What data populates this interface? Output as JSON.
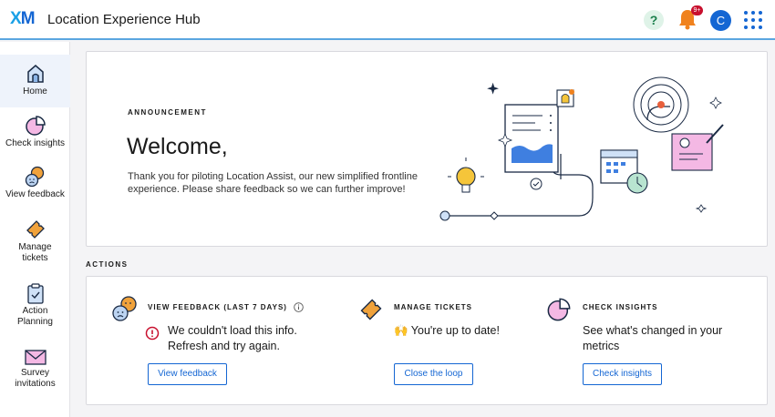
{
  "header": {
    "logo": "XM",
    "title": "Location Experience Hub",
    "help_label": "?",
    "notification_badge": "9+",
    "avatar_initial": "C"
  },
  "sidebar": {
    "items": [
      {
        "label": "Home",
        "icon": "home-icon",
        "active": true
      },
      {
        "label": "Check insights",
        "icon": "pie-chart-icon"
      },
      {
        "label": "View feedback",
        "icon": "faces-icon"
      },
      {
        "label": "Manage tickets",
        "icon": "ticket-icon"
      },
      {
        "label": "Action Planning",
        "icon": "clipboard-icon"
      },
      {
        "label": "Survey invitations",
        "icon": "envelope-icon"
      }
    ]
  },
  "announcement": {
    "eyebrow": "ANNOUNCEMENT",
    "heading": "Welcome,",
    "body": "Thank you for piloting Location Assist, our new simplified frontline experience. Please share feedback so we can further improve!"
  },
  "actions": {
    "label": "ACTIONS",
    "feedback": {
      "title": "VIEW FEEDBACK (LAST 7 DAYS)",
      "message": "We couldn't load this info. Refresh and try again.",
      "button": "View feedback"
    },
    "tickets": {
      "title": "MANAGE TICKETS",
      "message": "🙌 You're up to date!",
      "button": "Close the loop"
    },
    "insights": {
      "title": "CHECK INSIGHTS",
      "message": "See what's changed in your metrics",
      "button": "Check insights"
    }
  },
  "colors": {
    "brand_blue": "#1466d3",
    "top_border": "#5aa6e0",
    "error_red": "#c8102e",
    "icon_orange": "#f0a23b",
    "icon_pink": "#f4b8e4"
  }
}
